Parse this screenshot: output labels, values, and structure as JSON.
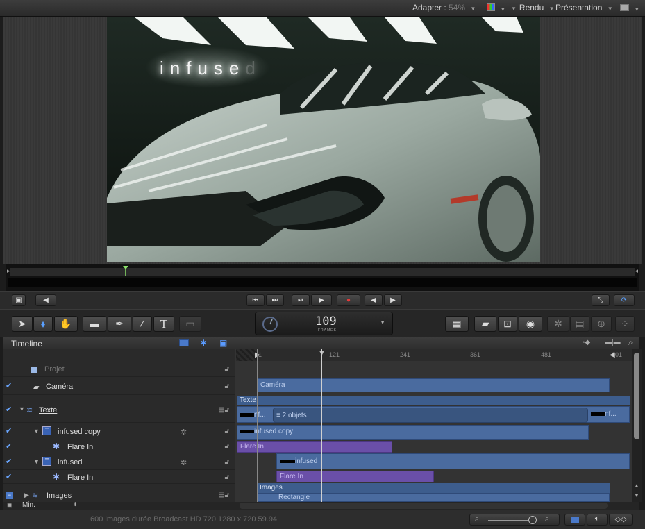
{
  "topbar": {
    "fit_label": "Adapter :",
    "fit_value": "54%",
    "render_label": "Rendu",
    "view_label": "Présentation"
  },
  "canvas": {
    "overlay_text": "infuse",
    "overlay_text_tail": "d"
  },
  "transport": {
    "buttons": [
      "⏮",
      "⏭",
      "⏯",
      "▶",
      "●",
      "◀",
      "▶"
    ]
  },
  "frame_counter": {
    "value": "109",
    "unit": "FRAMES"
  },
  "tools": {
    "text_tool": "T"
  },
  "timeline": {
    "title": "Timeline",
    "ruler_ticks": [
      "1",
      "121",
      "241",
      "361",
      "481",
      "601"
    ],
    "layers": [
      {
        "name": "Projet",
        "checked": false,
        "dim": true
      },
      {
        "name": "Caméra",
        "checked": true
      },
      {
        "name": "Texte",
        "checked": true
      },
      {
        "name": "infused copy",
        "checked": true
      },
      {
        "name": "Flare In",
        "checked": true
      },
      {
        "name": "infused",
        "checked": true
      },
      {
        "name": "Flare In",
        "checked": true
      },
      {
        "name": "Images",
        "checked": true
      }
    ],
    "bars": {
      "camera": "Caméra",
      "texte": "Texte",
      "inf_left": "nf...",
      "objects": "2 objets",
      "inf_right": "nf...",
      "infused_copy": "infused copy",
      "flare1": "Flare In",
      "infused": "infused",
      "flare2": "Flare In",
      "images": "Images",
      "rectangle": "Rectangle"
    },
    "zoom_mode": "Min."
  },
  "status": {
    "text": "600 images durée Broadcast HD 720 1280 x 720 59.94"
  },
  "colors": {
    "accent_blue": "#4a6b9f",
    "purple": "#6a4fa8",
    "check": "#6aa6ff"
  }
}
